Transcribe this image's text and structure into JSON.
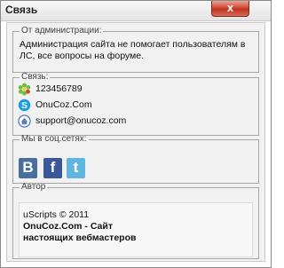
{
  "window": {
    "title": "Связь",
    "close_label": "x"
  },
  "sections": {
    "admin": {
      "legend": "От администрации:",
      "text": "Администрация сайта не помогает пользователям в ЛС, все вопросы на форуме."
    },
    "contact": {
      "legend": "Связь:",
      "items": [
        {
          "icon": "icq-icon",
          "text": "123456789"
        },
        {
          "icon": "skype-icon",
          "text": "OnuCoz.Com"
        },
        {
          "icon": "email-icon",
          "text": "support@onucoz.com"
        }
      ]
    },
    "social": {
      "legend": "Мы в соц.сетях:",
      "networks": [
        {
          "icon": "vk-icon",
          "glyph": "B"
        },
        {
          "icon": "facebook-icon",
          "glyph": "f"
        },
        {
          "icon": "twitter-icon",
          "glyph": "t"
        }
      ]
    },
    "author": {
      "legend": "Автор",
      "line1": "uScripts © 2011",
      "line2": "OnuCoz.Com - Сайт настоящих вебмастеров"
    }
  },
  "colors": {
    "vk": "#4a6f9c",
    "facebook": "#3b5998",
    "twitter": "#60b6de",
    "close": "#c0331f"
  }
}
